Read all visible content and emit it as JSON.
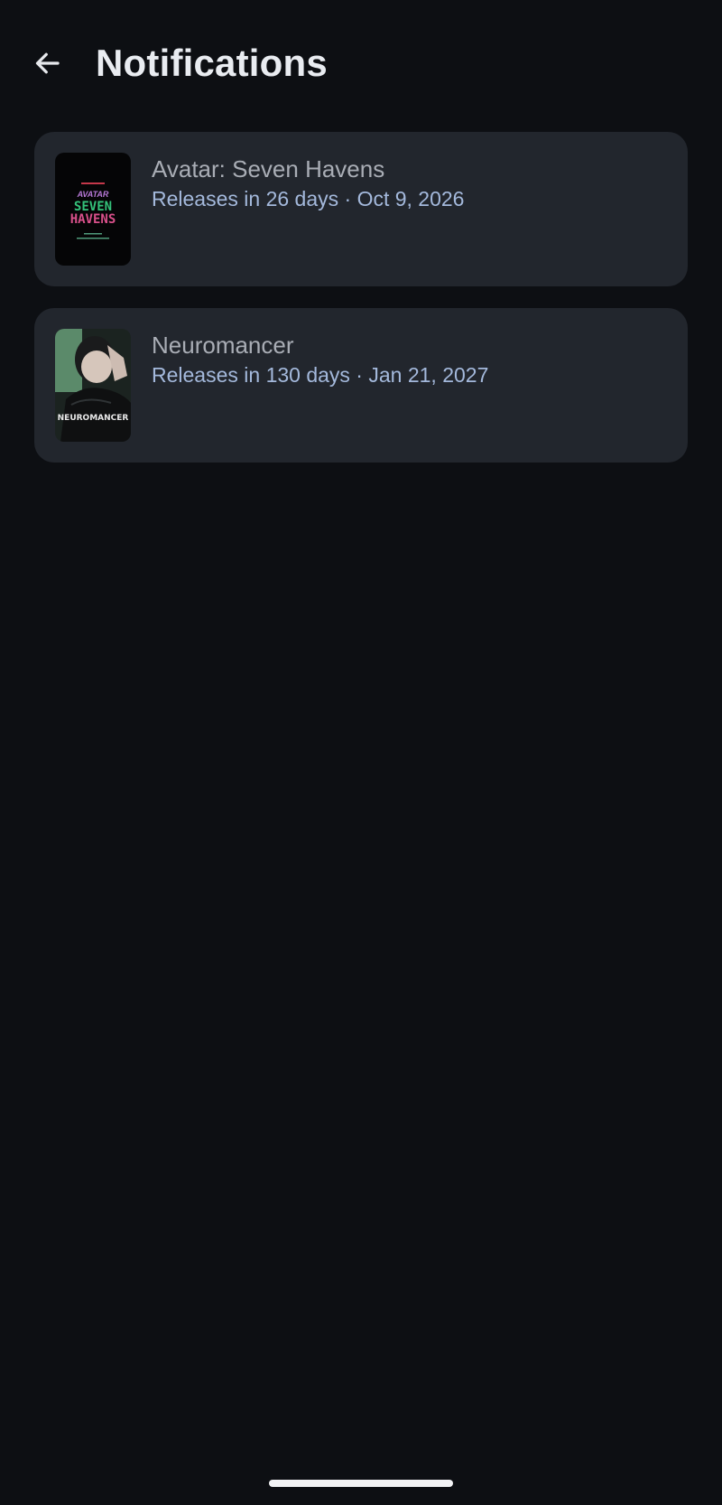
{
  "header": {
    "title": "Notifications",
    "back_icon": "arrow-left-icon"
  },
  "notifications": [
    {
      "title": "Avatar: Seven Havens",
      "subtitle": "Releases in 26 days · Oct 9, 2026",
      "poster": {
        "top_text": "AVATAR",
        "line1": "SEVEN",
        "line2": "HAVENS"
      }
    },
    {
      "title": "Neuromancer",
      "subtitle": "Releases in 130 days · Jan 21, 2027",
      "poster": {
        "text": "NEUROMANCER"
      }
    }
  ],
  "colors": {
    "background": "#0d0f13",
    "card": "#22262d",
    "title_text": "#a9adb5",
    "subtitle_text": "#a4b9dc",
    "header_text": "#e9ecf1"
  }
}
